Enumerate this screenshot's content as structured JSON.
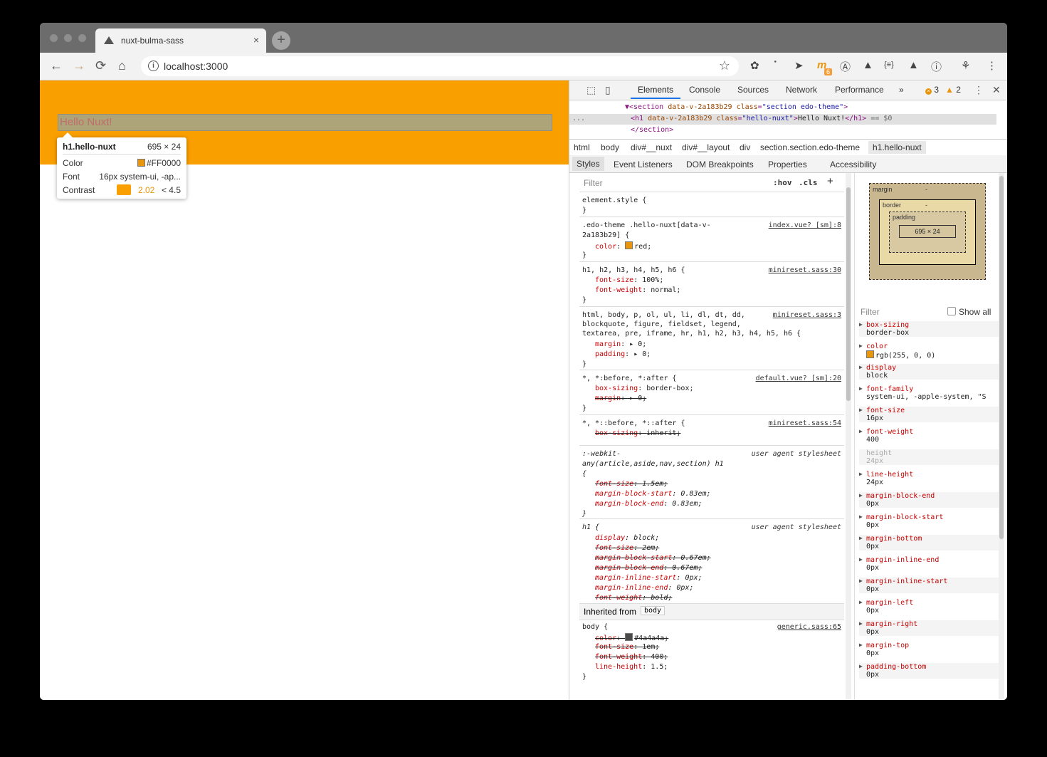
{
  "browser": {
    "tab_title": "nuxt-bulma-sass",
    "tab_close": "×",
    "new_tab": "+",
    "url": "localhost:3000",
    "nav": {
      "back": "←",
      "forward": "→",
      "reload": "⟳",
      "home": "⌂"
    },
    "info_icon": "i",
    "star": "☆",
    "extensions": [
      "✿",
      "⠁",
      "➤",
      "m",
      "Ⓐ",
      "▲",
      "{≡}",
      "▲",
      "ⓘ",
      "⚘",
      "⋮"
    ],
    "ext_badge": "6"
  },
  "page": {
    "banner_color": "#f99f00",
    "heading_text": "Hello Nuxt!",
    "tooltip": {
      "selector": "h1.hello-nuxt",
      "size": "695 × 24",
      "color_label": "Color",
      "color_value": "#FF0000",
      "font_label": "Font",
      "font_value": "16px system-ui, -ap...",
      "contrast_label": "Contrast",
      "contrast_ratio": "2.02",
      "contrast_threshold": "< 4.5"
    }
  },
  "devtools": {
    "tabs": [
      "Elements",
      "Console",
      "Sources",
      "Network",
      "Performance",
      "»"
    ],
    "error_count": "3",
    "warning_count": "2",
    "dom": {
      "line1_tag": "▼<section",
      "line1_attr1": "data-v-2a183b29",
      "line1_attr2n": "class",
      "line1_attr2v": "\"section edo-theme\"",
      "line1_end": ">",
      "dots": "...",
      "line2_open": "<h1",
      "line2_attr1": "data-v-2a183b29",
      "line2_attr2n": "class",
      "line2_attr2v": "\"hello-nuxt\"",
      "line2_text": "Hello Nuxt!",
      "line2_close": "</h1>",
      "line2_eq": "== $0",
      "line3": "</section>"
    },
    "breadcrumbs": [
      "html",
      "body",
      "div#__nuxt",
      "div#__layout",
      "div",
      "section.section.edo-theme",
      "h1.hello-nuxt"
    ],
    "subtabs": [
      "Styles",
      "Event Listeners",
      "DOM Breakpoints",
      "Properties",
      "Accessibility"
    ],
    "styles": {
      "filter_placeholder": "Filter",
      "hov": ":hov",
      "cls": ".cls",
      "plus": "+",
      "element_style": "element.style {",
      "close": "}",
      "r1_sel1": ".edo-theme .hello-nuxt[data-v-",
      "r1_sel2": "2a183b29] {",
      "r1_src": "index.vue? [sm]:8",
      "r1_prop": "color",
      "r1_val": "red;",
      "r2_sel": "h1, h2, h3, h4, h5, h6 {",
      "r2_src": "minireset.sass:30",
      "r2_p1": "font-size",
      "r2_v1": "100%;",
      "r2_p2": "font-weight",
      "r2_v2": "normal;",
      "r3_sel1": "html, body, p, ol, ul, li, dl, dt, dd,",
      "r3_sel2": "blockquote, figure, fieldset, legend,",
      "r3_sel3": "textarea, pre, iframe, hr, h1, h2, h3, h4, h5, h6 {",
      "r3_src": "minireset.sass:3",
      "r3_p1": "margin",
      "r3_v1": "0;",
      "r3_p2": "padding",
      "r3_v2": "0;",
      "r4_sel": "*, *:before, *:after {",
      "r4_src": "default.vue? [sm]:20",
      "r4_p1": "box-sizing",
      "r4_v1": "border-box;",
      "r4_p2": "margin",
      "r4_v2": "0;",
      "r5_sel": "*, *::before, *::after {",
      "r5_src": "minireset.sass:54",
      "r5_p1": "box-sizing",
      "r5_v1": "inherit;",
      "r6_sel1": ":-webkit-",
      "r6_sel2": "any(article,aside,nav,section) h1",
      "r6_sel3": "{",
      "ua_label": "user agent stylesheet",
      "r6_p1": "font-size",
      "r6_v1": "1.5em;",
      "r6_p2": "margin-block-start",
      "r6_v2": "0.83em;",
      "r6_p3": "margin-block-end",
      "r6_v3": "0.83em;",
      "r7_sel": "h1 {",
      "r7_p1": "display",
      "r7_v1": "block;",
      "r7_p2": "font-size",
      "r7_v2": "2em;",
      "r7_p3": "margin-block-start",
      "r7_v3": "0.67em;",
      "r7_p4": "margin-block-end",
      "r7_v4": "0.67em;",
      "r7_p5": "margin-inline-start",
      "r7_v5": "0px;",
      "r7_p6": "margin-inline-end",
      "r7_v6": "0px;",
      "r7_p7": "font-weight",
      "r7_v7": "bold;",
      "inherited_label": "Inherited from",
      "inherited_tag": "body",
      "r8_sel": "body {",
      "r8_src": "generic.sass:65",
      "r8_p1": "color",
      "r8_v1": "#4a4a4a;",
      "r8_p2": "font-size",
      "r8_v2": "1em;",
      "r8_p3": "font-weight",
      "r8_v3": "400;",
      "r8_p4": "line-height",
      "r8_v4": "1.5;"
    },
    "computed": {
      "margin_label": "margin",
      "border_label": "border",
      "padding_label": "padding",
      "dash": "-",
      "content_size": "695 × 24",
      "filter_placeholder": "Filter",
      "show_all": "Show all",
      "properties": [
        {
          "name": "box-sizing",
          "value": "border-box"
        },
        {
          "name": "color",
          "value": "rgb(255, 0, 0)"
        },
        {
          "name": "display",
          "value": "block"
        },
        {
          "name": "font-family",
          "value": "system-ui, -apple-system, \"S"
        },
        {
          "name": "font-size",
          "value": "16px"
        },
        {
          "name": "font-weight",
          "value": "400"
        },
        {
          "name": "height",
          "value": "24px"
        },
        {
          "name": "line-height",
          "value": "24px"
        },
        {
          "name": "margin-block-end",
          "value": "0px"
        },
        {
          "name": "margin-block-start",
          "value": "0px"
        },
        {
          "name": "margin-bottom",
          "value": "0px"
        },
        {
          "name": "margin-inline-end",
          "value": "0px"
        },
        {
          "name": "margin-inline-start",
          "value": "0px"
        },
        {
          "name": "margin-left",
          "value": "0px"
        },
        {
          "name": "margin-right",
          "value": "0px"
        },
        {
          "name": "margin-top",
          "value": "0px"
        },
        {
          "name": "padding-bottom",
          "value": "0px"
        }
      ]
    }
  },
  "colors": {
    "accent_orange": "#f99f00",
    "red_swatch": "#e8960c",
    "body_color_swatch": "#4a4a4a"
  }
}
